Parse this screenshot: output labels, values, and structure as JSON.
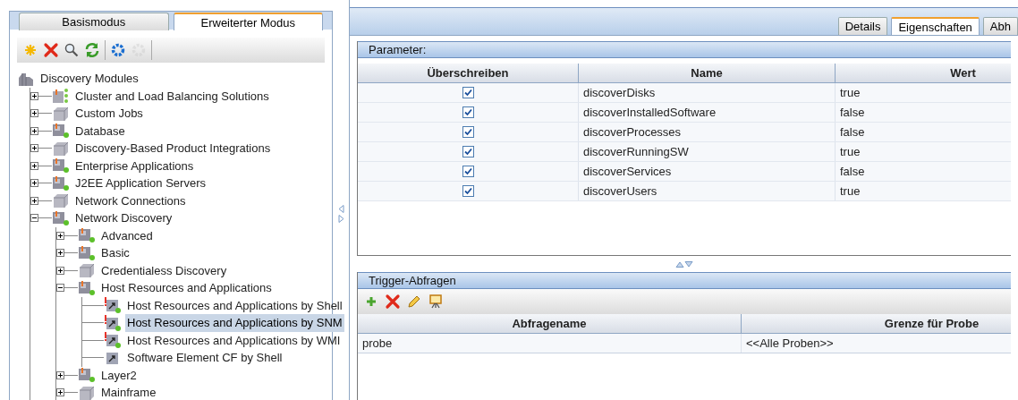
{
  "left_tabs": [
    {
      "label": "Basismodus",
      "selected": false
    },
    {
      "label": "Erweiterter Modus",
      "selected": true
    }
  ],
  "toolbar": [
    {
      "kind": "new",
      "disabled": false
    },
    {
      "kind": "delete",
      "disabled": false
    },
    {
      "kind": "search",
      "disabled": false
    },
    {
      "kind": "refresh",
      "disabled": false
    },
    {
      "kind": "gear",
      "disabled": false
    },
    {
      "kind": "gear",
      "disabled": true
    }
  ],
  "tree": {
    "label": "Discovery Modules",
    "kind": "root",
    "selected": false,
    "children": [
      {
        "label": "Cluster and Load Balancing Solutions",
        "kind": "cluster",
        "selected": false,
        "expanded": false
      },
      {
        "label": "Custom Jobs",
        "kind": "box",
        "selected": false,
        "expanded": false
      },
      {
        "label": "Database",
        "kind": "module",
        "selected": false,
        "expanded": false
      },
      {
        "label": "Discovery-Based Product Integrations",
        "kind": "box",
        "selected": false,
        "expanded": false
      },
      {
        "label": "Enterprise Applications",
        "kind": "module",
        "selected": false,
        "expanded": false
      },
      {
        "label": "J2EE Application Servers",
        "kind": "module",
        "selected": false,
        "expanded": false
      },
      {
        "label": "Network Connections",
        "kind": "box",
        "selected": false,
        "expanded": false
      },
      {
        "label": "Network Discovery",
        "kind": "module",
        "selected": false,
        "expanded": true,
        "children": [
          {
            "label": "Advanced",
            "kind": "module",
            "selected": false,
            "expanded": false
          },
          {
            "label": "Basic",
            "kind": "module",
            "selected": false,
            "expanded": false
          },
          {
            "label": "Credentialess Discovery",
            "kind": "box",
            "selected": false,
            "expanded": false
          },
          {
            "label": "Host Resources and Applications",
            "kind": "module",
            "selected": false,
            "expanded": true,
            "children": [
              {
                "label": "Host Resources and Applications by Shell",
                "kind": "job",
                "selected": false
              },
              {
                "label": "Host Resources and Applications by SNM",
                "kind": "job",
                "selected": true
              },
              {
                "label": "Host Resources and Applications by WMI",
                "kind": "job",
                "selected": false
              },
              {
                "label": "Software Element CF by Shell",
                "kind": "job-plain",
                "selected": false
              }
            ]
          },
          {
            "label": "Layer2",
            "kind": "module",
            "selected": false,
            "expanded": false
          },
          {
            "label": "Mainframe",
            "kind": "box",
            "selected": false,
            "expanded": false
          }
        ]
      }
    ]
  },
  "detail_tabs": [
    {
      "label": "Details",
      "selected": false
    },
    {
      "label": "Eigenschaften",
      "selected": true
    },
    {
      "label": "Abh",
      "selected": false
    }
  ],
  "parameters": {
    "title": "Parameter:",
    "columns": [
      "Überschreiben",
      "Name",
      "Wert"
    ],
    "rows": [
      {
        "checked": true,
        "name": "discoverDisks",
        "value": "true"
      },
      {
        "checked": true,
        "name": "discoverInstalledSoftware",
        "value": "false"
      },
      {
        "checked": true,
        "name": "discoverProcesses",
        "value": "false"
      },
      {
        "checked": true,
        "name": "discoverRunningSW",
        "value": "true"
      },
      {
        "checked": true,
        "name": "discoverServices",
        "value": "false"
      },
      {
        "checked": true,
        "name": "discoverUsers",
        "value": "true"
      }
    ]
  },
  "triggers": {
    "title": "Trigger-Abfragen",
    "toolbar": [
      {
        "kind": "add"
      },
      {
        "kind": "delete"
      },
      {
        "kind": "edit"
      },
      {
        "kind": "show"
      }
    ],
    "columns": [
      "Abfragename",
      "Grenze für Probe"
    ],
    "rows": [
      {
        "query": "probe",
        "limit": "<<Alle Proben>>"
      }
    ]
  }
}
